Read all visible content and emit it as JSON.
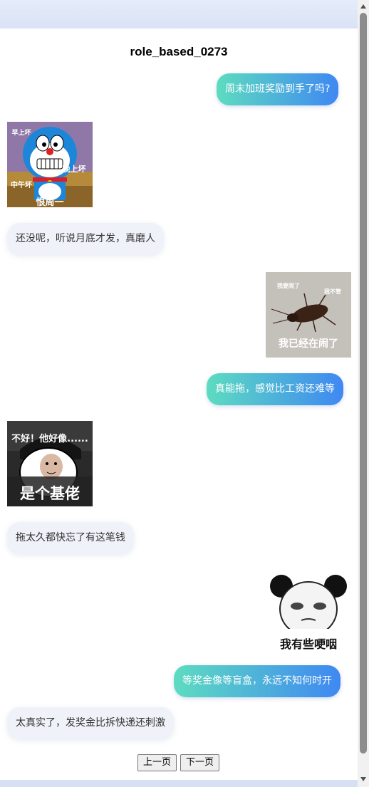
{
  "page": {
    "title": "role_based_0273"
  },
  "messages": [
    {
      "side": "right",
      "text": "周末加班奖励到手了吗?"
    },
    {
      "side": "left",
      "sticker": "doraemon-sticker",
      "caption_lines": [
        "早上坏",
        "晚上坏",
        "中午坏",
        "恨周一"
      ]
    },
    {
      "side": "left",
      "text": "还没呢，听说月底才发，真磨人"
    },
    {
      "side": "right",
      "sticker": "cockroach-sticker",
      "caption_lines": [
        "我要闹了",
        "我不管",
        "我已经在闹了"
      ]
    },
    {
      "side": "right",
      "text": "真能拖，感觉比工资还难等"
    },
    {
      "side": "left",
      "sticker": "cartoon-face-sticker",
      "caption_lines": [
        "不好！他好像......",
        "是个基佬"
      ]
    },
    {
      "side": "left",
      "text": "拖太久都快忘了有这笔钱"
    },
    {
      "side": "right",
      "sticker": "panda-sticker",
      "caption_lines": [
        "我有些哽咽"
      ]
    },
    {
      "side": "right",
      "text": "等奖金像等盲盒，永远不知何时开"
    },
    {
      "side": "left",
      "text": "太真实了，发奖金比拆快递还刺激"
    }
  ],
  "pager": {
    "prev_label": "上一页",
    "next_label": "下一页"
  },
  "colors": {
    "bubble_right_start": "#5ddcc0",
    "bubble_right_end": "#3f88f2",
    "bubble_left": "#eff2f8"
  }
}
